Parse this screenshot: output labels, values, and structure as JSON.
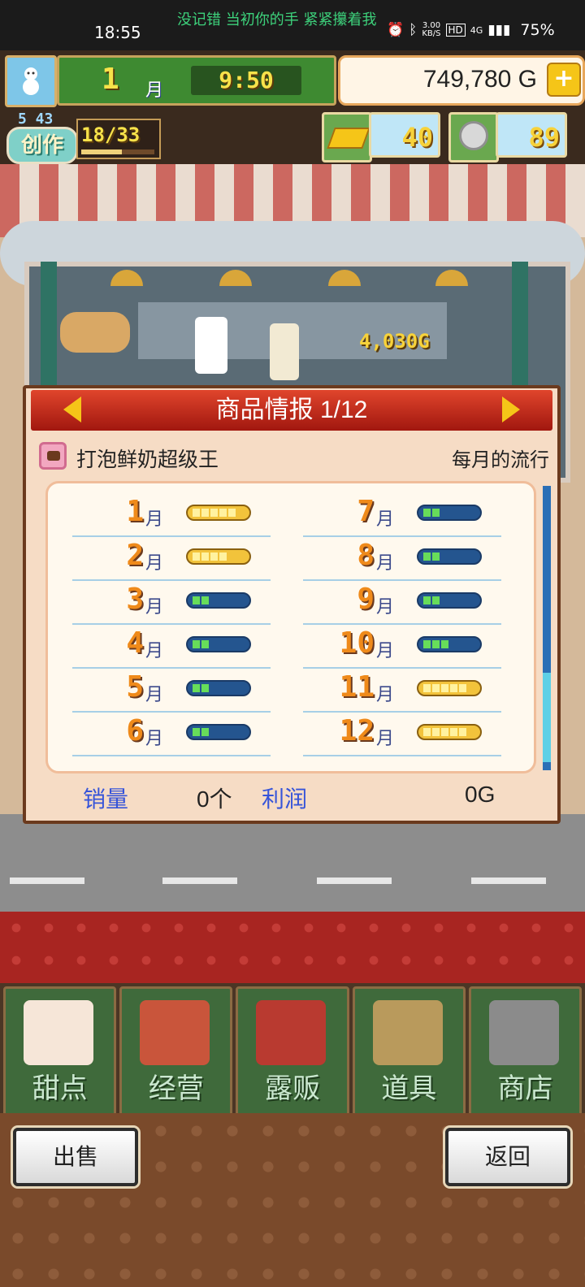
{
  "status": {
    "time": "18:55",
    "song": "没记错 当初你的手 紧紧攥着我",
    "speed_top": "3.00",
    "speed_unit": "KB/S",
    "hd": "HD",
    "network": "4G",
    "battery": "75%"
  },
  "hud": {
    "month_number": "1",
    "month_label": "月",
    "clock": "9:50",
    "money": "749,780 G",
    "create_level": "5 43",
    "create_label": "创作",
    "create_progress": "18/33",
    "create_progress_fraction": 0.55,
    "gold_count": "40",
    "medal_count": "89"
  },
  "scene": {
    "earn_popup": "4,030G"
  },
  "dialog": {
    "title": "商品情报 1/12",
    "item_name": "打泡鲜奶超级王",
    "trend_label": "每月的流行",
    "month_unit": "月",
    "months": [
      {
        "m": "1",
        "level": 5
      },
      {
        "m": "2",
        "level": 4
      },
      {
        "m": "3",
        "level": 2
      },
      {
        "m": "4",
        "level": 2
      },
      {
        "m": "5",
        "level": 2
      },
      {
        "m": "6",
        "level": 2
      },
      {
        "m": "7",
        "level": 2
      },
      {
        "m": "8",
        "level": 2
      },
      {
        "m": "9",
        "level": 2
      },
      {
        "m": "10",
        "level": 3
      },
      {
        "m": "11",
        "level": 5
      },
      {
        "m": "12",
        "level": 5
      }
    ],
    "sales_label": "销量",
    "sales_value": "0个",
    "profit_label": "利润",
    "profit_value": "0G"
  },
  "nav": [
    {
      "label": "甜点",
      "icon": "cake-icon"
    },
    {
      "label": "经营",
      "icon": "shop-icon"
    },
    {
      "label": "露贩",
      "icon": "food-truck-icon"
    },
    {
      "label": "道具",
      "icon": "items-bag-icon"
    },
    {
      "label": "商店",
      "icon": "shopping-cart-icon"
    }
  ],
  "bottom": {
    "sell_label": "出售",
    "back_label": "返回"
  },
  "colors": {
    "title_red": "#c2281b",
    "accent_gold": "#f5c518",
    "label_blue": "#3654d9",
    "nav_green": "#3f6a3b"
  }
}
